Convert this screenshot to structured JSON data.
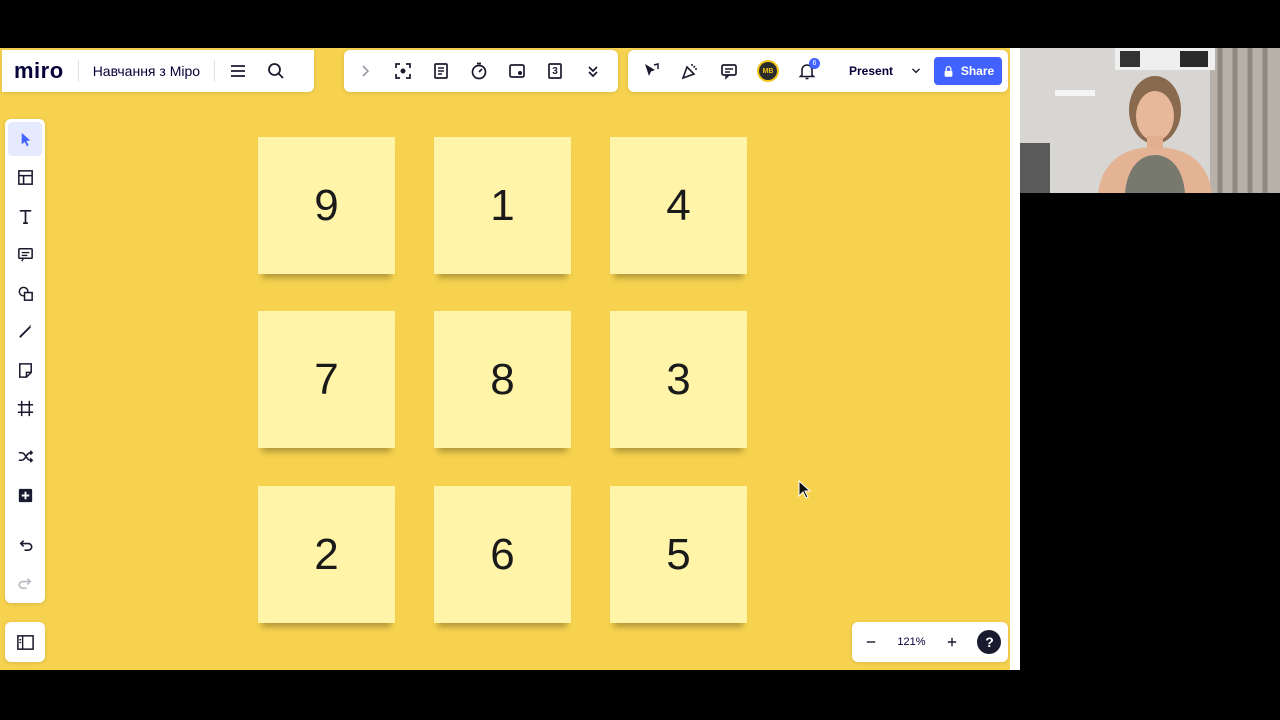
{
  "app": {
    "logo": "miro",
    "board_title": "Навчання з Міро"
  },
  "topbar": {
    "present_label": "Present",
    "share_label": "Share",
    "avatar_initials": "MB",
    "notification_count": "6",
    "counter_icon_value": "3"
  },
  "left_toolbar": {
    "tools": [
      "select",
      "templates",
      "text",
      "sticky-comment",
      "shapes",
      "pen",
      "sticky-note",
      "frame",
      "connector",
      "more"
    ]
  },
  "stickies": [
    "9",
    "1",
    "4",
    "7",
    "8",
    "3",
    "2",
    "6",
    "5"
  ],
  "zoom": {
    "level": "121%",
    "help": "?"
  },
  "colors": {
    "board": "#f6d24f",
    "sticky": "#fff4a8",
    "accent": "#4262ff"
  }
}
